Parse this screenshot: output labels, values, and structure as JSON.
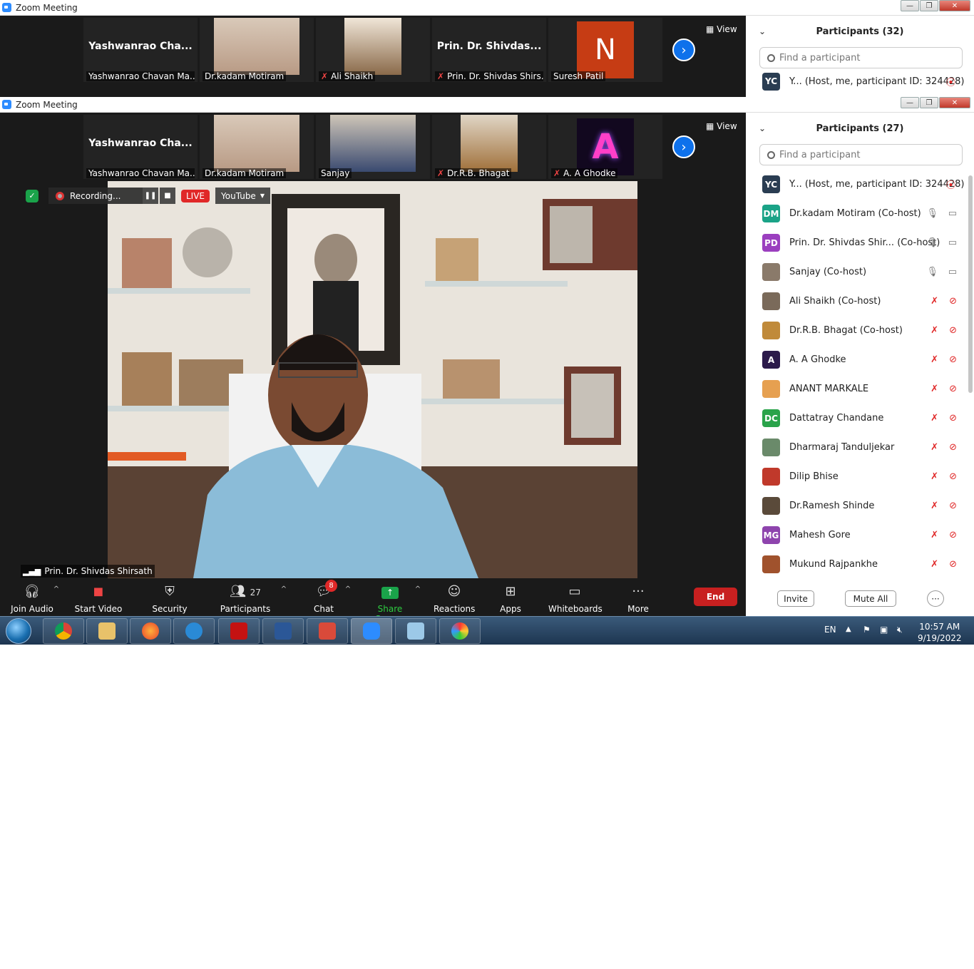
{
  "window1": {
    "title": "Zoom Meeting",
    "tiles": [
      {
        "big": "Yashwanrao  Cha...",
        "name": "Yashwanrao Chavan Ma...",
        "muted": false
      },
      {
        "big": "",
        "name": "Dr.kadam Motiram",
        "muted": false
      },
      {
        "big": "",
        "name": "Ali Shaikh",
        "muted": true
      },
      {
        "big": "Prin.  Dr.  Shivdas...",
        "name": "Prin. Dr. Shivdas Shirs...",
        "muted": true
      },
      {
        "big": "N",
        "name": "Suresh Patil",
        "muted": false
      }
    ],
    "view_label": "View",
    "participants_title": "Participants (32)",
    "search_placeholder": "Find a participant",
    "first_row": {
      "initials": "YC",
      "text": "Y...  (Host, me, participant ID: 324428)"
    }
  },
  "window2": {
    "title": "Zoom Meeting",
    "tiles": [
      {
        "big": "Yashwanrao  Cha...",
        "name": "Yashwanrao Chavan Ma...",
        "muted": false
      },
      {
        "big": "",
        "name": "Dr.kadam Motiram",
        "muted": false
      },
      {
        "big": "",
        "name": "Sanjay",
        "muted": false
      },
      {
        "big": "",
        "name": "Dr.R.B. Bhagat",
        "muted": true
      },
      {
        "big": "",
        "name": "A. A Ghodke",
        "muted": true
      }
    ],
    "view_label": "View",
    "recording": {
      "label": "Recording...",
      "live": "LIVE",
      "platform": "YouTube"
    },
    "speaker_name": "Prin. Dr. Shivdas Shirsath",
    "participants_title": "Participants (27)",
    "search_placeholder": "Find a participant",
    "participants": [
      {
        "initials": "YC",
        "color": "#2a3d52",
        "name": "Y...  (Host, me, participant ID: 324428)",
        "status": "rec"
      },
      {
        "initials": "DM",
        "color": "#1aa387",
        "name": "Dr.kadam Motiram (Co-host)",
        "status": "on"
      },
      {
        "initials": "PD",
        "color": "#9b3fbf",
        "name": "Prin. Dr. Shivdas Shir...  (Co-host)",
        "status": "on"
      },
      {
        "initials": "",
        "color": "#8a7a6a",
        "name": "Sanjay (Co-host)",
        "status": "on"
      },
      {
        "initials": "",
        "color": "#7a6a5a",
        "name": "Ali Shaikh (Co-host)",
        "status": "off"
      },
      {
        "initials": "",
        "color": "#c08a3a",
        "name": "Dr.R.B. Bhagat (Co-host)",
        "status": "off"
      },
      {
        "initials": "A",
        "color": "#2b1a4a",
        "name": "A. A Ghodke",
        "status": "off"
      },
      {
        "initials": "",
        "color": "#e6a050",
        "name": "ANANT MARKALE",
        "status": "off"
      },
      {
        "initials": "DC",
        "color": "#2aa34a",
        "name": "Dattatray Chandane",
        "status": "off"
      },
      {
        "initials": "",
        "color": "#6a8a6a",
        "name": "Dharmaraj Tanduljekar",
        "status": "off"
      },
      {
        "initials": "",
        "color": "#c0392b",
        "name": "Dilip Bhise",
        "status": "off"
      },
      {
        "initials": "",
        "color": "#5a4a3a",
        "name": "Dr.Ramesh Shinde",
        "status": "off"
      },
      {
        "initials": "MG",
        "color": "#8e44ad",
        "name": "Mahesh Gore",
        "status": "off"
      },
      {
        "initials": "",
        "color": "#a0522d",
        "name": "Mukund Rajpankhe",
        "status": "off"
      }
    ],
    "footer": {
      "invite": "Invite",
      "mute_all": "Mute All",
      "more": "···"
    }
  },
  "toolbar": {
    "join_audio": "Join Audio",
    "start_video": "Start Video",
    "security": "Security",
    "participants": "Participants",
    "participants_count": "27",
    "chat": "Chat",
    "chat_badge": "8",
    "share_screen": "Share Screen",
    "reactions": "Reactions",
    "apps": "Apps",
    "whiteboards": "Whiteboards",
    "more": "More",
    "end": "End"
  },
  "taskbar": {
    "lang": "EN",
    "time": "10:57 AM",
    "date": "9/19/2022"
  }
}
